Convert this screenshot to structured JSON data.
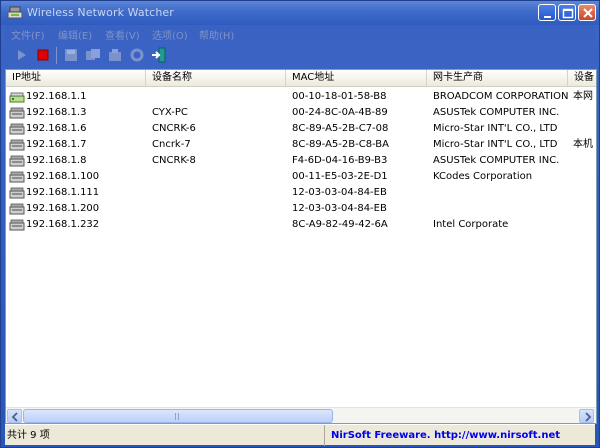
{
  "window": {
    "title": "Wireless Network Watcher"
  },
  "menu": {
    "items": [
      "文件(F)",
      "编辑(E)",
      "查看(V)",
      "选项(O)",
      "帮助(H)"
    ]
  },
  "toolbar": {
    "buttons": [
      "start-scan",
      "stop-scan",
      "save",
      "copy",
      "properties",
      "refresh",
      "exit"
    ]
  },
  "list": {
    "columns": [
      "IP地址",
      "设备名称",
      "MAC地址",
      "网卡生产商",
      "设备"
    ],
    "rows": [
      {
        "icon": "router-icon",
        "ip": "192.168.1.1",
        "device": "",
        "mac": "00-10-18-01-58-B8",
        "vendor": "BROADCOM CORPORATION",
        "extra": "本网"
      },
      {
        "icon": "computer-icon",
        "ip": "192.168.1.3",
        "device": "CYX-PC",
        "mac": "00-24-8C-0A-4B-89",
        "vendor": "ASUSTek COMPUTER INC.",
        "extra": ""
      },
      {
        "icon": "computer-icon",
        "ip": "192.168.1.6",
        "device": "CNCRK-6",
        "mac": "8C-89-A5-2B-C7-08",
        "vendor": "Micro-Star INT'L CO., LTD",
        "extra": ""
      },
      {
        "icon": "computer-icon",
        "ip": "192.168.1.7",
        "device": "Cncrk-7",
        "mac": "8C-89-A5-2B-C8-BA",
        "vendor": "Micro-Star INT'L CO., LTD",
        "extra": "本机"
      },
      {
        "icon": "computer-icon",
        "ip": "192.168.1.8",
        "device": "CNCRK-8",
        "mac": "F4-6D-04-16-B9-B3",
        "vendor": "ASUSTek COMPUTER INC.",
        "extra": ""
      },
      {
        "icon": "computer-icon",
        "ip": "192.168.1.100",
        "device": "",
        "mac": "00-11-E5-03-2E-D1",
        "vendor": "KCodes Corporation",
        "extra": ""
      },
      {
        "icon": "computer-icon",
        "ip": "192.168.1.111",
        "device": "",
        "mac": "12-03-03-04-84-EB",
        "vendor": "",
        "extra": ""
      },
      {
        "icon": "computer-icon",
        "ip": "192.168.1.200",
        "device": "",
        "mac": "12-03-03-04-84-EB",
        "vendor": "",
        "extra": ""
      },
      {
        "icon": "computer-icon",
        "ip": "192.168.1.232",
        "device": "",
        "mac": "8C-A9-82-49-42-6A",
        "vendor": "Intel Corporate",
        "extra": ""
      }
    ]
  },
  "status": {
    "count": "共计 9 项",
    "link": "NirSoft Freeware.  http://www.nirsoft.net"
  }
}
